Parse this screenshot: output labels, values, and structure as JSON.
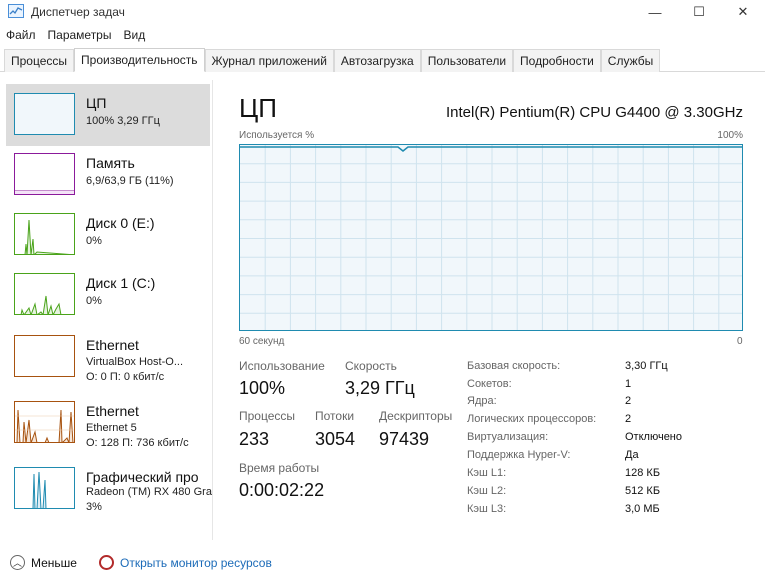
{
  "window": {
    "title": "Диспетчер задач",
    "minimize_glyph": "—",
    "maximize_glyph": "☐",
    "close_glyph": "✕"
  },
  "menu": [
    "Файл",
    "Параметры",
    "Вид"
  ],
  "tabs": [
    "Процессы",
    "Производительность",
    "Журнал приложений",
    "Автозагрузка",
    "Пользователи",
    "Подробности",
    "Службы"
  ],
  "active_tab": "Производительность",
  "sidebar": {
    "items": [
      {
        "title": "ЦП",
        "sub1": "100% 3,29 ГГц",
        "sub2": "",
        "color": "#1f8bb0",
        "selected": true
      },
      {
        "title": "Память",
        "sub1": "6,9/63,9 ГБ (11%)",
        "sub2": "",
        "color": "#8b1a9b"
      },
      {
        "title": "Диск 0 (E:)",
        "sub1": "0%",
        "sub2": "",
        "color": "#4aa31a"
      },
      {
        "title": "Диск 1 (C:)",
        "sub1": "0%",
        "sub2": "",
        "color": "#4aa31a"
      },
      {
        "title": "Ethernet",
        "sub1": "VirtualBox Host-O...",
        "sub2": "О: 0 П: 0 кбит/с",
        "color": "#a7520f"
      },
      {
        "title": "Ethernet",
        "sub1": "Ethernet 5",
        "sub2": "О: 128 П: 736 кбит/с",
        "color": "#a7520f"
      },
      {
        "title": "Графический про",
        "sub1": "Radeon (TM) RX 480 Gra",
        "sub2": "3%",
        "color": "#1f8bb0"
      }
    ]
  },
  "main": {
    "heading": "ЦП",
    "model": "Intel(R) Pentium(R) CPU G4400 @ 3.30GHz",
    "graph_label_left": "Используется %",
    "graph_label_right": "100%",
    "graph_time_label": "60 секунд",
    "graph_zero_label": "0",
    "cpu_utilization_percent": 100,
    "stats": {
      "usage_label": "Использование",
      "usage_value": "100%",
      "speed_label": "Скорость",
      "speed_value": "3,29 ГГц",
      "processes_label": "Процессы",
      "processes_value": "233",
      "threads_label": "Потоки",
      "threads_value": "3054",
      "handles_label": "Дескрипторы",
      "handles_value": "97439",
      "uptime_label": "Время работы",
      "uptime_value": "0:00:02:22"
    },
    "details": [
      {
        "label": "Базовая скорость:",
        "value": "3,30 ГГц"
      },
      {
        "label": "Сокетов:",
        "value": "1"
      },
      {
        "label": "Ядра:",
        "value": "2"
      },
      {
        "label": "Логических процессоров:",
        "value": "2"
      },
      {
        "label": "Виртуализация:",
        "value": "Отключено"
      },
      {
        "label": "Поддержка Hyper-V:",
        "value": "Да"
      },
      {
        "label": "Кэш L1:",
        "value": "128 КБ"
      },
      {
        "label": "Кэш L2:",
        "value": "512 КБ"
      },
      {
        "label": "Кэш L3:",
        "value": "3,0 МБ"
      }
    ]
  },
  "footer": {
    "fewer_details": "Меньше",
    "resource_monitor": "Открыть монитор ресурсов"
  }
}
